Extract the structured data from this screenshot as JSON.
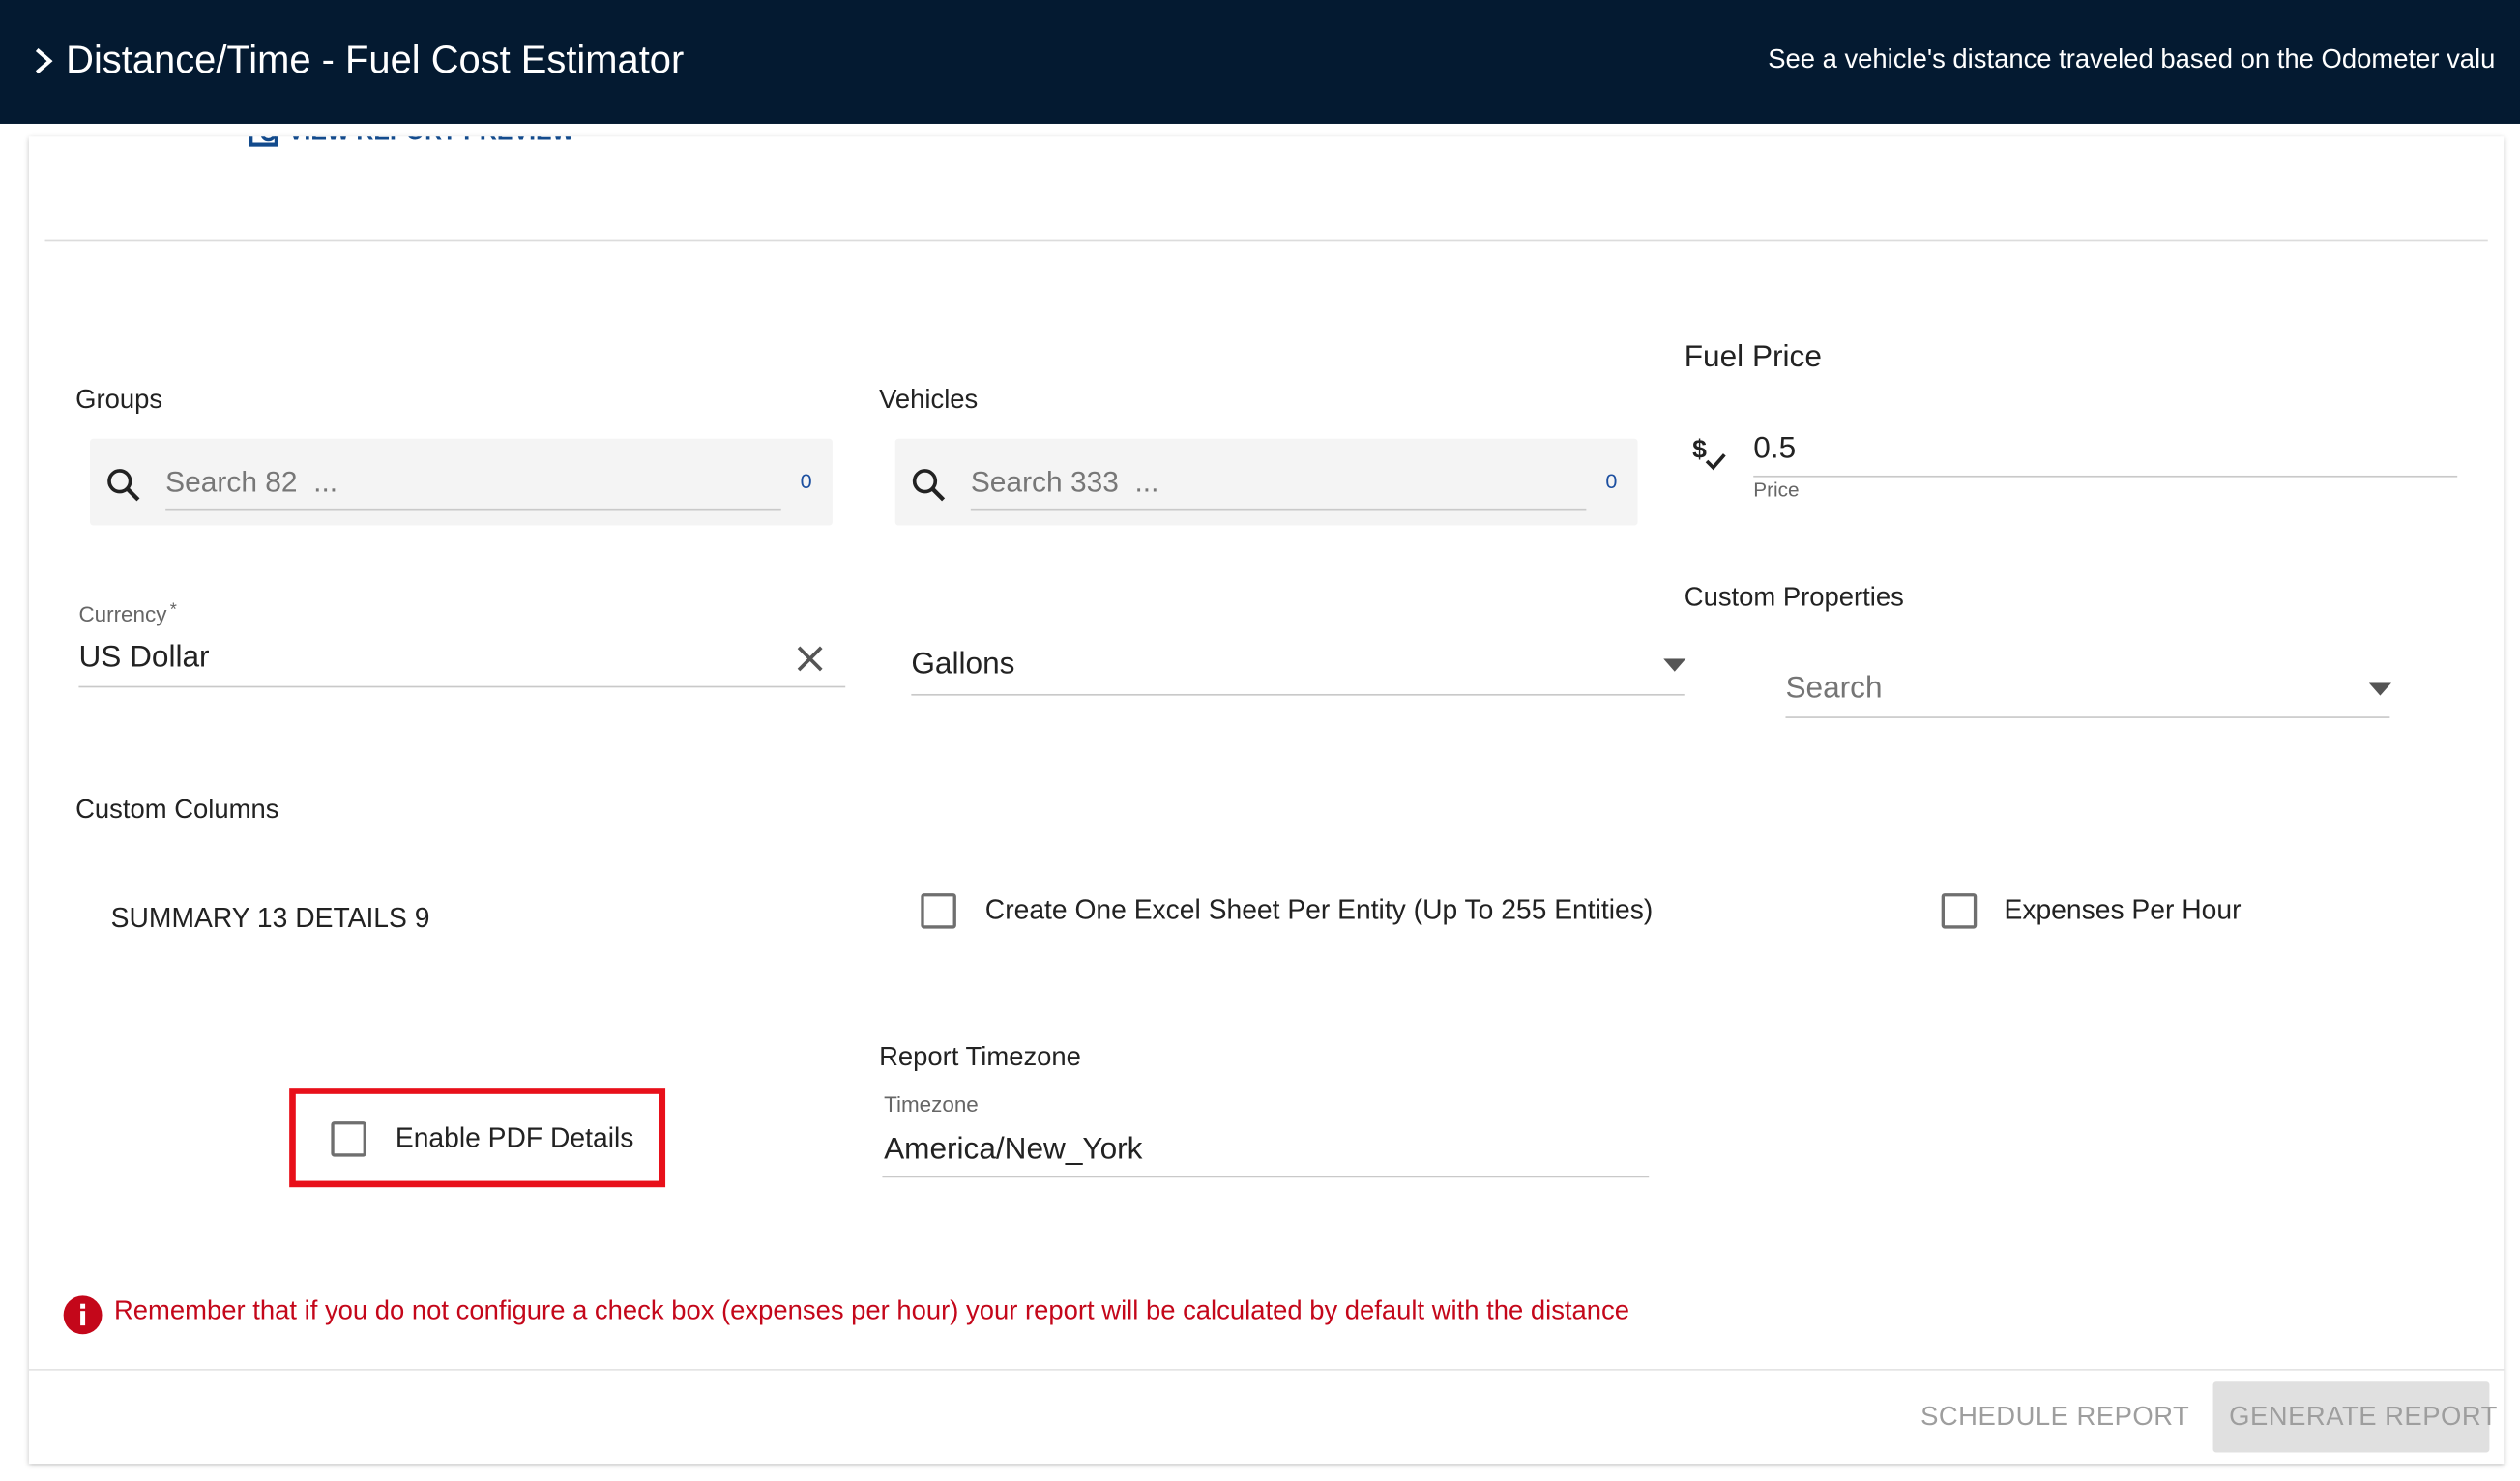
{
  "header": {
    "title": "Distance/Time - Fuel Cost Estimator",
    "description": "See a vehicle's distance traveled based on the Odometer valu",
    "background_color": "#041a31"
  },
  "preview": {
    "label": "VIEW REPORT PREVIEW"
  },
  "groups": {
    "label": "Groups",
    "placeholder": "Search 82  ...",
    "count": "0"
  },
  "vehicles": {
    "label": "Vehicles",
    "placeholder": "Search 333  ...",
    "count": "0"
  },
  "fuel_price": {
    "label": "Fuel Price",
    "value": "0.5",
    "helper": "Price",
    "icon": "dollar-check-icon"
  },
  "currency": {
    "label": "Currency",
    "required_mark": "*",
    "value": "US Dollar",
    "clear_icon": "close-icon"
  },
  "unit": {
    "value": "Gallons",
    "icon": "dropdown-arrow-icon"
  },
  "custom_properties": {
    "label": "Custom Properties",
    "placeholder": "Search",
    "icon": "dropdown-arrow-icon"
  },
  "custom_columns": {
    "label": "Custom Columns",
    "summary": "SUMMARY 13 DETAILS 9"
  },
  "options": {
    "excel_per_entity": "Create One Excel Sheet Per Entity (Up To 255 Entities)",
    "expenses_per_hour": "Expenses Per Hour",
    "enable_pdf_details": "Enable PDF Details"
  },
  "timezone": {
    "section_label": "Report Timezone",
    "field_label": "Timezone",
    "value": "America/New_York"
  },
  "warning": {
    "text": "Remember that if you do not configure a check box (expenses per hour) your report will be calculated by default with the distance",
    "icon": "info-icon",
    "color": "#c4071a"
  },
  "actions": {
    "schedule": "SCHEDULE REPORT",
    "generate": "GENERATE REPORT"
  },
  "highlight_color": "#e8101a"
}
